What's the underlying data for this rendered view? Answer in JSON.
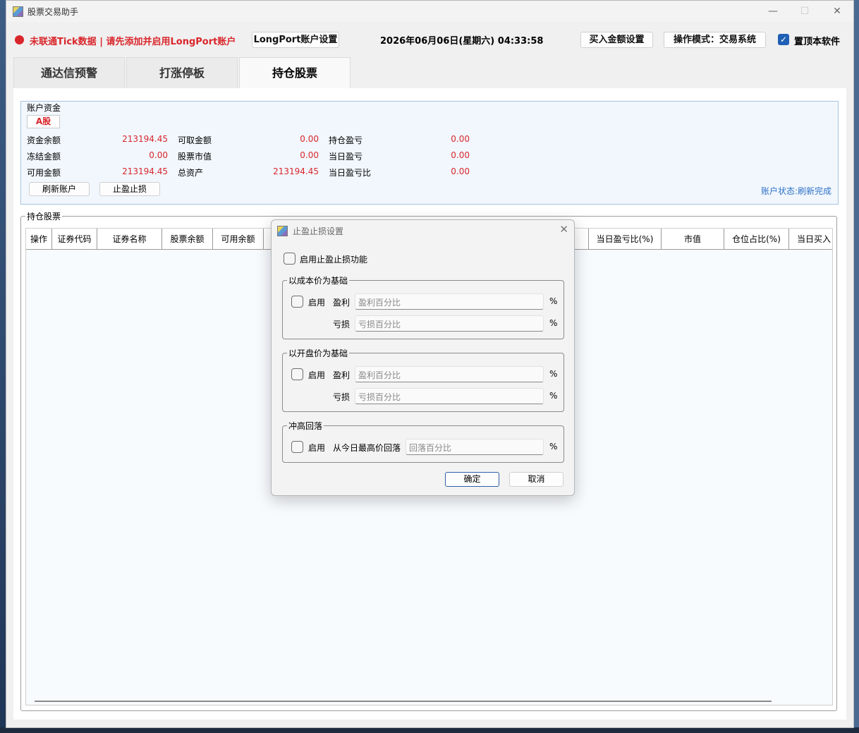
{
  "window": {
    "title": "股票交易助手",
    "minimize": "—",
    "maximize": "☐",
    "close": "✕"
  },
  "topbar": {
    "warning": "未联通Tick数据 | 请先添加并启用LongPort账户",
    "longport_btn": "LongPort账户设置",
    "datetime": "2026年06月06日(星期六) 04:33:58",
    "buy_amount_btn": "买入金额设置",
    "mode_btn": "操作模式：交易系统",
    "pin_label": "置顶本软件",
    "pin_checked": true
  },
  "tabs": [
    "通达信预警",
    "打涨停板",
    "持仓股票"
  ],
  "active_tab": 2,
  "account": {
    "group_title": "账户资金",
    "market_tab": "A股",
    "rows": [
      [
        {
          "label": "资金余额",
          "value": "213194.45"
        },
        {
          "label": "可取金额",
          "value": "0.00"
        },
        {
          "label": "持仓盈亏",
          "value": "0.00"
        }
      ],
      [
        {
          "label": "冻结金额",
          "value": "0.00"
        },
        {
          "label": "股票市值",
          "value": "0.00"
        },
        {
          "label": "当日盈亏",
          "value": "0.00"
        }
      ],
      [
        {
          "label": "可用金额",
          "value": "213194.45"
        },
        {
          "label": "总资产",
          "value": "213194.45"
        },
        {
          "label": "当日盈亏比",
          "value": "0.00"
        }
      ]
    ],
    "refresh_btn": "刷新账户",
    "stop_btn": "止盈止损",
    "status": "账户状态:刷新完成"
  },
  "holdings": {
    "title": "持仓股票",
    "columns": [
      "操作",
      "证券代码",
      "证券名称",
      "股票余额",
      "可用余额",
      "当日盈亏比(%)",
      "市值",
      "仓位占比(%)",
      "当日买入"
    ]
  },
  "dialog": {
    "title": "止盈止损设置",
    "close": "✕",
    "enable_all": "启用止盈止损功能",
    "cost": {
      "title": "以成本价为基础",
      "enable": "启用",
      "profit_label": "盈利",
      "profit_placeholder": "盈利百分比",
      "loss_label": "亏损",
      "loss_placeholder": "亏损百分比"
    },
    "open": {
      "title": "以开盘价为基础",
      "enable": "启用",
      "profit_label": "盈利",
      "profit_placeholder": "盈利百分比",
      "loss_label": "亏损",
      "loss_placeholder": "亏损百分比"
    },
    "pullback": {
      "title": "冲高回落",
      "enable": "启用",
      "label": "从今日最高价回落",
      "placeholder": "回落百分比"
    },
    "percent": "%",
    "ok": "确定",
    "cancel": "取消"
  },
  "colors": {
    "warning_red": "#d9262b",
    "link_blue": "#2f72c8",
    "check_blue": "#1f5fb5"
  }
}
